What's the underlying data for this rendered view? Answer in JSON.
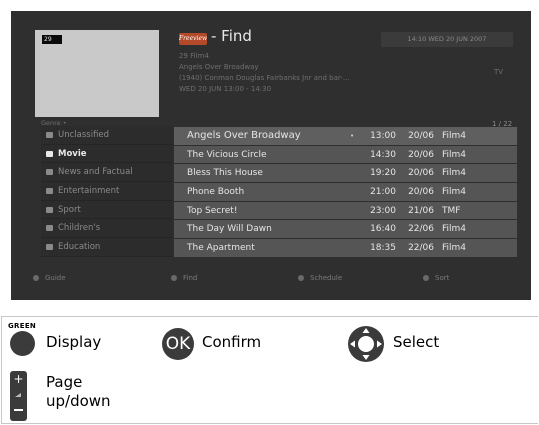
{
  "screen": {
    "channel_number": "29",
    "freeview_logo_text": "Freeview",
    "title": "- Find",
    "datetime": "14:10 WED 20 JUN 2007",
    "info_lines": [
      "29 Film4",
      "Angels Over Broadway",
      "(1940) Conman Douglas Fairbanks Jnr and bar-...",
      "WED 20 JUN 13:00 - 14:30"
    ],
    "tv_label": "TV",
    "genre_label": "Genre •",
    "page_counter": "1 / 22"
  },
  "genres": [
    {
      "label": "Unclassified",
      "icon": "folder-icon"
    },
    {
      "label": "Movie",
      "icon": "film-icon"
    },
    {
      "label": "News and Factual",
      "icon": "news-icon"
    },
    {
      "label": "Entertainment",
      "icon": "star-icon"
    },
    {
      "label": "Sport",
      "icon": "ball-icon"
    },
    {
      "label": "Children's",
      "icon": "child-icon"
    },
    {
      "label": "Education",
      "icon": "graduation-icon"
    }
  ],
  "highlighted_genre": "Movie",
  "programmes": [
    {
      "title": "Angels Over Broadway",
      "marker": "•",
      "time": "13:00",
      "date": "20/06",
      "channel": "Film4"
    },
    {
      "title": "The Vicious Circle",
      "marker": "",
      "time": "14:30",
      "date": "20/06",
      "channel": "Film4"
    },
    {
      "title": "Bless This House",
      "marker": "",
      "time": "19:20",
      "date": "20/06",
      "channel": "Film4"
    },
    {
      "title": "Phone Booth",
      "marker": "",
      "time": "21:00",
      "date": "20/06",
      "channel": "Film4"
    },
    {
      "title": "Top Secret!",
      "marker": "",
      "time": "23:00",
      "date": "21/06",
      "channel": "TMF"
    },
    {
      "title": "The Day Will Dawn",
      "marker": "",
      "time": "16:40",
      "date": "22/06",
      "channel": "Film4"
    },
    {
      "title": "The Apartment",
      "marker": "",
      "time": "18:35",
      "date": "22/06",
      "channel": "Film4"
    }
  ],
  "footer": {
    "guide": "Guide",
    "find": "Find",
    "schedule": "Schedule",
    "sort": "Sort"
  },
  "legend": {
    "green_key": "GREEN",
    "display": "Display",
    "ok_key": "OK",
    "confirm": "Confirm",
    "select": "Select",
    "page": "Page",
    "page_line2": "up/down"
  },
  "colors": {
    "tv_background": "#2f2f2f",
    "row_background": "#555555",
    "button_dark": "#3b3b3b"
  }
}
